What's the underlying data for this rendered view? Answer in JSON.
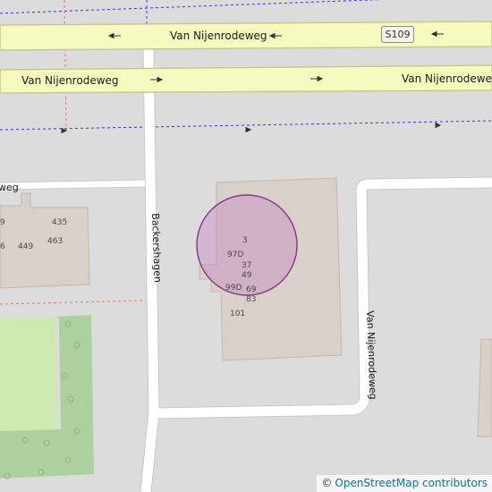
{
  "roads": {
    "main_north": "Van Nijenrodeweg",
    "main_south_left": "Van Nijenrodeweg",
    "main_south_right": "Van Nijenrodeweg",
    "west_partial": "weg",
    "backershagen": "Backershagen",
    "east_street": "Van Nijenrodeweg",
    "shield": "S109"
  },
  "addresses": {
    "left_9": "9",
    "left_435": "435",
    "left_6": "6",
    "left_449": "449",
    "left_463": "463",
    "a3": "3",
    "a97d": "97D",
    "a37": "37",
    "a49": "49",
    "a99d": "99D",
    "a69": "69",
    "a83": "83",
    "a101": "101"
  },
  "attribution": {
    "symbol": "©",
    "text": "OpenStreetMap contributors"
  },
  "colors": {
    "background": "#dddcdc",
    "major_road_fill": "#f7fabf",
    "major_road_casing": "#c6ca8f",
    "minor_road": "#ffffff",
    "building": "#d9d0c9",
    "park": "#cdebb0",
    "wood": "#add19e",
    "marker_fill": "#c080c0",
    "marker_stroke": "#8d3a8d",
    "dashed_blue": "#3333ff",
    "dashed_red": "#f07070"
  },
  "marker": {
    "type": "radius-circle",
    "center_address": "3"
  }
}
